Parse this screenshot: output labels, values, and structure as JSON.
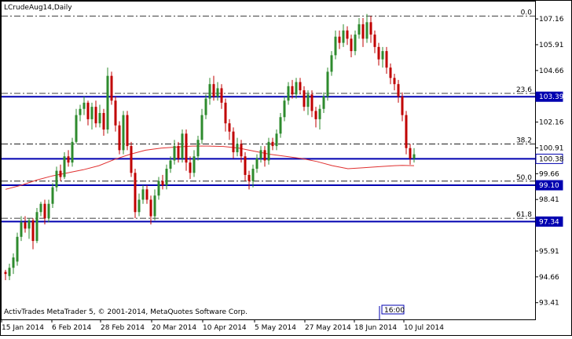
{
  "chart_data": {
    "type": "candlestick",
    "symbol_title": "LCrudeAug14,Daily",
    "watermark": "ActivTrades MetaTrader 5, © 2001-2014, MetaQuotes Software Corp.",
    "time_marker": "16:00",
    "y_ticks": [
      "107.16",
      "105.91",
      "104.66",
      "102.16",
      "100.91",
      "99.66",
      "98.41",
      "95.91",
      "94.66",
      "93.41"
    ],
    "ylim": [
      92.6,
      108.0
    ],
    "x_tick_labels": [
      "15 Jan 2014",
      "6 Feb 2014",
      "28 Feb 2014",
      "20 Mar 2014",
      "10 Apr 2014",
      "5 May 2014",
      "27 May 2014",
      "18 Jun 2014",
      "10 Jul 2014"
    ],
    "horizontal_levels": [
      {
        "name": "resistance-103-39",
        "value": 103.39,
        "label": "103.39",
        "style": "solid",
        "boxed": true
      },
      {
        "name": "current-price-100-38",
        "value": 100.38,
        "label": "100.38",
        "style": "solid",
        "boxed": true,
        "current": true
      },
      {
        "name": "support-99-10",
        "value": 99.1,
        "label": "99.10",
        "style": "solid",
        "boxed": true
      },
      {
        "name": "support-97-34",
        "value": 97.34,
        "label": "97.34",
        "style": "solid",
        "boxed": true
      }
    ],
    "fibonacci_levels": [
      {
        "label": "0.0",
        "value": 107.3
      },
      {
        "label": "23.6",
        "value": 103.55
      },
      {
        "label": "38.2",
        "value": 101.1
      },
      {
        "label": "50.0",
        "value": 99.3
      },
      {
        "label": "61.8",
        "value": 97.5
      }
    ],
    "moving_average_points": [
      [
        0,
        98.9
      ],
      [
        20,
        99.1
      ],
      [
        40,
        99.35
      ],
      [
        60,
        99.55
      ],
      [
        80,
        99.7
      ],
      [
        100,
        99.85
      ],
      [
        120,
        100.05
      ],
      [
        140,
        100.35
      ],
      [
        160,
        100.6
      ],
      [
        180,
        100.8
      ],
      [
        200,
        100.9
      ],
      [
        220,
        100.95
      ],
      [
        240,
        101.0
      ],
      [
        260,
        101.0
      ],
      [
        280,
        100.98
      ],
      [
        300,
        100.9
      ],
      [
        320,
        100.75
      ],
      [
        340,
        100.6
      ],
      [
        360,
        100.5
      ],
      [
        380,
        100.4
      ],
      [
        400,
        100.25
      ],
      [
        420,
        100.05
      ],
      [
        440,
        99.9
      ],
      [
        460,
        99.95
      ],
      [
        480,
        100.0
      ],
      [
        500,
        100.05
      ],
      [
        510,
        100.06
      ],
      [
        525,
        100.05
      ]
    ],
    "candles": [
      [
        94.9,
        94.8,
        95.0,
        94.5
      ],
      [
        94.7,
        95.1,
        95.3,
        94.5
      ],
      [
        95.1,
        95.6,
        95.8,
        94.8
      ],
      [
        95.4,
        96.6,
        96.8,
        95.2
      ],
      [
        96.6,
        97.3,
        97.6,
        96.4
      ],
      [
        97.3,
        97.0,
        97.6,
        96.8
      ],
      [
        97.0,
        97.4,
        97.5,
        96.5
      ],
      [
        97.4,
        96.4,
        97.5,
        96.0
      ],
      [
        96.4,
        97.8,
        98.0,
        96.3
      ],
      [
        97.8,
        98.2,
        98.3,
        97.6
      ],
      [
        98.2,
        97.5,
        98.4,
        97.2
      ],
      [
        97.5,
        98.2,
        98.4,
        97.3
      ],
      [
        98.2,
        99.0,
        99.2,
        98.0
      ],
      [
        99.0,
        99.8,
        100.0,
        98.8
      ],
      [
        99.8,
        99.5,
        100.1,
        99.3
      ],
      [
        99.5,
        100.5,
        100.7,
        99.4
      ],
      [
        100.5,
        100.2,
        100.8,
        100.0
      ],
      [
        100.2,
        101.2,
        101.4,
        100.0
      ],
      [
        101.2,
        102.5,
        102.8,
        101.1
      ],
      [
        102.5,
        102.8,
        103.0,
        102.2
      ],
      [
        102.8,
        103.1,
        103.4,
        102.5
      ],
      [
        103.1,
        102.3,
        103.2,
        102.0
      ],
      [
        102.3,
        102.9,
        103.1,
        101.8
      ],
      [
        102.9,
        102.1,
        103.2,
        101.9
      ],
      [
        102.1,
        102.6,
        103.0,
        101.9
      ],
      [
        102.6,
        101.8,
        102.8,
        101.5
      ],
      [
        101.8,
        104.4,
        104.8,
        101.6
      ],
      [
        104.4,
        103.2,
        104.6,
        103.0
      ],
      [
        103.2,
        102.0,
        103.4,
        101.7
      ],
      [
        102.0,
        100.8,
        102.2,
        100.6
      ],
      [
        100.8,
        102.5,
        102.7,
        100.6
      ],
      [
        102.5,
        101.0,
        102.7,
        100.8
      ],
      [
        101.0,
        99.7,
        101.2,
        99.5
      ],
      [
        99.7,
        97.8,
        99.9,
        97.5
      ],
      [
        97.8,
        98.4,
        98.7,
        97.6
      ],
      [
        98.4,
        98.9,
        99.1,
        98.2
      ],
      [
        98.9,
        98.4,
        99.1,
        98.2
      ],
      [
        98.4,
        97.6,
        98.6,
        97.2
      ],
      [
        97.6,
        98.6,
        98.9,
        97.4
      ],
      [
        98.6,
        99.3,
        99.5,
        98.4
      ],
      [
        99.3,
        99.1,
        99.6,
        98.9
      ],
      [
        99.1,
        99.9,
        100.1,
        98.9
      ],
      [
        99.9,
        100.3,
        100.5,
        99.7
      ],
      [
        100.3,
        101.0,
        101.3,
        100.1
      ],
      [
        101.0,
        100.4,
        101.2,
        100.2
      ],
      [
        100.4,
        101.6,
        101.8,
        100.2
      ],
      [
        101.6,
        100.2,
        101.8,
        99.8
      ],
      [
        100.2,
        99.7,
        100.5,
        99.4
      ],
      [
        99.7,
        100.5,
        100.8,
        99.5
      ],
      [
        100.5,
        101.3,
        101.5,
        100.3
      ],
      [
        101.3,
        102.5,
        102.8,
        101.1
      ],
      [
        102.5,
        103.3,
        103.5,
        102.3
      ],
      [
        103.3,
        104.0,
        104.3,
        103.0
      ],
      [
        104.0,
        103.4,
        104.4,
        103.2
      ],
      [
        103.4,
        103.8,
        104.1,
        103.2
      ],
      [
        103.8,
        103.1,
        104.0,
        102.8
      ],
      [
        103.1,
        102.1,
        103.3,
        101.7
      ],
      [
        102.1,
        101.7,
        102.3,
        101.3
      ],
      [
        101.7,
        100.7,
        101.9,
        100.4
      ],
      [
        100.7,
        101.1,
        101.4,
        100.5
      ],
      [
        101.1,
        100.5,
        101.3,
        100.2
      ],
      [
        100.5,
        99.6,
        100.7,
        99.3
      ],
      [
        99.6,
        99.3,
        99.8,
        98.9
      ],
      [
        99.3,
        99.9,
        100.1,
        99.0
      ],
      [
        99.9,
        100.4,
        100.6,
        99.7
      ],
      [
        100.4,
        100.8,
        101.0,
        100.2
      ],
      [
        100.8,
        100.3,
        101.0,
        100.0
      ],
      [
        100.3,
        101.2,
        101.4,
        100.1
      ],
      [
        101.2,
        101.0,
        101.4,
        100.8
      ],
      [
        101.0,
        101.6,
        101.8,
        100.8
      ],
      [
        101.6,
        102.4,
        102.6,
        101.4
      ],
      [
        102.4,
        103.2,
        103.4,
        102.2
      ],
      [
        103.2,
        103.9,
        104.1,
        103.0
      ],
      [
        103.9,
        103.5,
        104.2,
        103.3
      ],
      [
        103.5,
        104.1,
        104.3,
        103.3
      ],
      [
        104.1,
        103.7,
        104.3,
        103.5
      ],
      [
        103.7,
        102.9,
        103.9,
        102.7
      ],
      [
        102.9,
        103.5,
        103.7,
        102.5
      ],
      [
        103.5,
        102.7,
        103.7,
        102.4
      ],
      [
        102.7,
        102.3,
        102.9,
        101.9
      ],
      [
        102.3,
        102.8,
        103.0,
        101.8
      ],
      [
        102.8,
        103.4,
        103.6,
        102.6
      ],
      [
        103.4,
        104.6,
        104.8,
        103.2
      ],
      [
        104.6,
        105.4,
        105.6,
        104.4
      ],
      [
        105.4,
        106.3,
        106.6,
        105.2
      ],
      [
        106.3,
        106.0,
        106.6,
        105.7
      ],
      [
        106.0,
        106.6,
        106.9,
        105.8
      ],
      [
        106.6,
        106.2,
        106.8,
        105.9
      ],
      [
        106.2,
        105.6,
        106.4,
        105.3
      ],
      [
        105.6,
        106.4,
        106.6,
        105.4
      ],
      [
        106.4,
        106.9,
        107.2,
        106.2
      ],
      [
        106.9,
        106.2,
        107.2,
        105.8
      ],
      [
        106.2,
        107.0,
        107.4,
        106.0
      ],
      [
        107.0,
        106.4,
        107.3,
        106.0
      ],
      [
        106.4,
        105.8,
        106.6,
        105.5
      ],
      [
        105.8,
        105.2,
        106.0,
        104.9
      ],
      [
        105.2,
        105.6,
        105.8,
        104.8
      ],
      [
        105.6,
        104.8,
        105.8,
        104.5
      ],
      [
        104.8,
        104.3,
        105.0,
        104.0
      ],
      [
        104.3,
        104.0,
        104.5,
        103.7
      ],
      [
        104.0,
        103.4,
        104.2,
        103.1
      ],
      [
        103.4,
        102.5,
        103.6,
        102.2
      ],
      [
        102.5,
        100.9,
        102.7,
        100.6
      ],
      [
        100.9,
        100.4,
        101.1,
        100.1
      ],
      [
        100.4,
        100.6,
        100.9,
        100.2
      ]
    ]
  },
  "colors": {
    "bull_candle": "#2e8b2e",
    "bear_candle": "#c00000",
    "level_line": "#0000b0",
    "fib_line": "#000000",
    "ma_line": "#e03030",
    "price_box_bg": "#0000b0",
    "price_box_text": "#ffffff",
    "grid_tick": "#000000"
  }
}
